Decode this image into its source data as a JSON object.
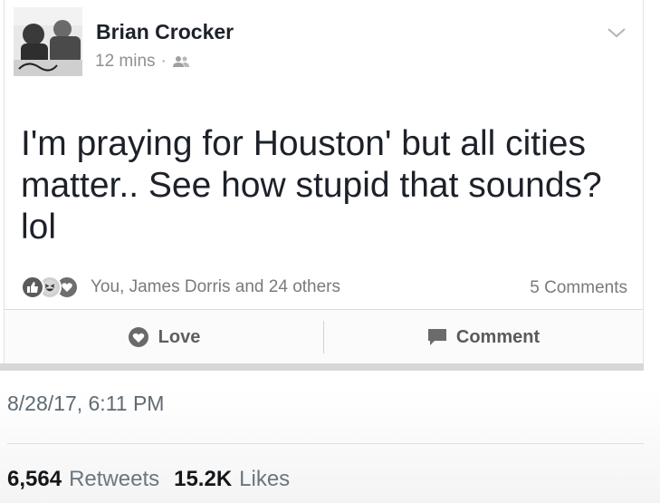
{
  "post": {
    "author": "Brian Crocker",
    "time": "12 mins",
    "separator": "·",
    "audience_icon": "friends-icon",
    "text": "I'm praying for Houston' but all cities matter.. See how stupid that sounds? lol",
    "reactions": {
      "icons": [
        "like-icon",
        "haha-icon",
        "love-icon"
      ],
      "summary": "You, James Dorris and 24 others"
    },
    "comments_count": "5 Comments",
    "actions": {
      "love_label": "Love",
      "comment_label": "Comment"
    }
  },
  "tweet": {
    "timestamp": "8/28/17, 6:11 PM",
    "retweets_count": "6,564",
    "retweets_label": "Retweets",
    "likes_count": "15.2K",
    "likes_label": "Likes"
  }
}
